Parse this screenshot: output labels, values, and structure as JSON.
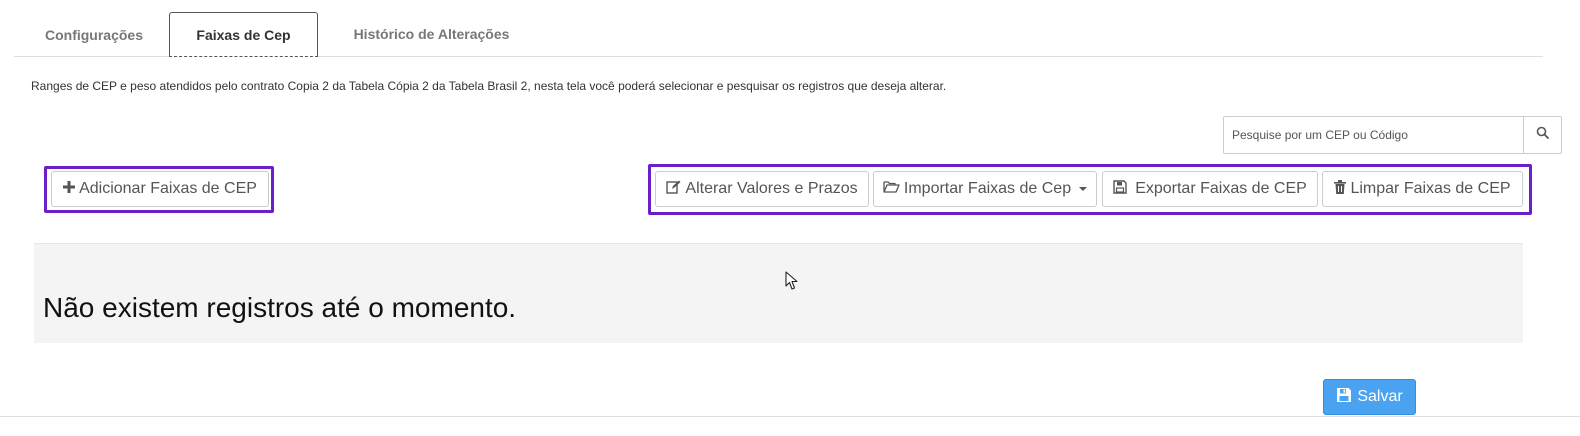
{
  "tabs": [
    {
      "label": "Configurações"
    },
    {
      "label": "Faixas de Cep"
    },
    {
      "label": "Histórico de Alterações"
    }
  ],
  "description": "Ranges de CEP e peso atendidos pelo contrato Copia 2 da Tabela Cópia 2 da Tabela Brasil 2, nesta tela você poderá selecionar e pesquisar os registros que deseja alterar.",
  "search": {
    "placeholder": "Pesquise por um CEP ou Código",
    "value": "",
    "icon": "search-icon"
  },
  "toolbar": {
    "add_label": "Adicionar Faixas de CEP",
    "alter_label": "Alterar Valores e Prazos",
    "import_label": "Importar Faixas de Cep",
    "export_label": "Exportar Faixas de CEP",
    "clear_label": "Limpar Faixas de CEP",
    "icons": [
      "plus-icon",
      "edit-icon",
      "folder-open-icon",
      "floppy-disk-icon",
      "trash-icon"
    ]
  },
  "empty_message": "Não existem registros até o momento.",
  "save_label": "Salvar",
  "colors": {
    "highlight": "#6a1fc9",
    "save_button": "#4aa3f0",
    "empty_panel": "#f4f4f4"
  }
}
